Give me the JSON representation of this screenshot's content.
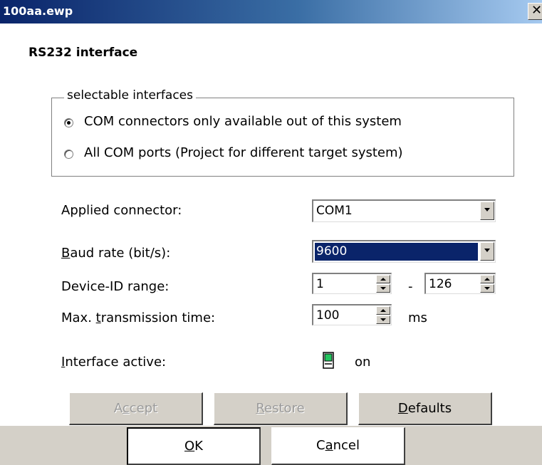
{
  "window": {
    "title": "100aa.ewp",
    "close_glyph": "✕"
  },
  "heading": "RS232 interface",
  "group": {
    "legend": "selectable interfaces",
    "options": [
      {
        "label": "COM connectors only available out of this system",
        "checked": true
      },
      {
        "label": "All COM ports (Project for different target system)",
        "checked": false
      }
    ]
  },
  "fields": {
    "connector": {
      "label": "Applied connector:",
      "value": "COM1"
    },
    "baud": {
      "label_pre": "",
      "label_key": "B",
      "label_post": "aud rate (bit/s):",
      "value": "9600"
    },
    "device_id": {
      "label_pre": "Device-ID ran",
      "label_key": "g",
      "label_post": "e:",
      "from": "1",
      "separator": "-",
      "to": "126"
    },
    "max_time": {
      "label_pre": "Max. ",
      "label_key": "t",
      "label_post": "ransmission time:",
      "value": "100",
      "unit": "ms"
    },
    "active": {
      "label_pre": "",
      "label_key": "I",
      "label_post": "nterface active:",
      "state": "on",
      "led_color": "#22c55e"
    }
  },
  "buttons": {
    "accept": {
      "pre": "A",
      "key": "c",
      "post": "cept",
      "enabled": false
    },
    "restore": {
      "pre": "",
      "key": "R",
      "post": "estore",
      "enabled": false
    },
    "defaults": {
      "pre": "",
      "key": "D",
      "post": "efaults",
      "enabled": true
    },
    "ok": {
      "pre": "",
      "key": "O",
      "post": "K"
    },
    "cancel": {
      "pre": "C",
      "key": "a",
      "post": "ncel"
    }
  },
  "colors": {
    "selection": "#0a246a",
    "face": "#d4d0c8"
  }
}
